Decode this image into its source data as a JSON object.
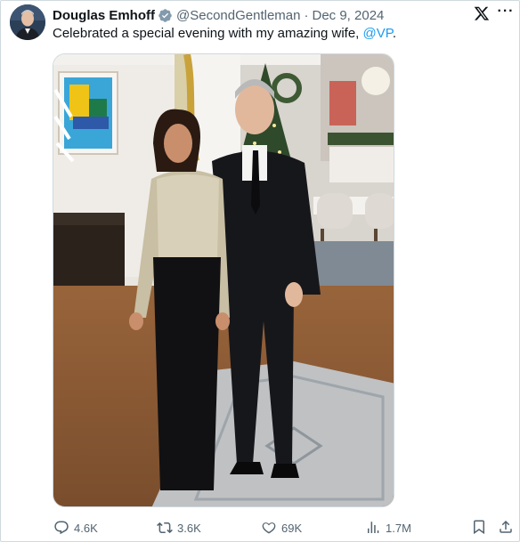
{
  "tweet": {
    "author_name": "Douglas Emhoff",
    "author_handle": "@SecondGentleman",
    "separator": "·",
    "date": "Dec 9, 2024",
    "text_before": "Celebrated a special evening with my amazing wife, ",
    "mention": "@VP",
    "text_after": "."
  },
  "icons": {
    "verified": "verified-badge-icon",
    "platform": "x-logo-icon",
    "more": "more-options-icon"
  },
  "more_label": "···",
  "actions": {
    "replies": "4.6K",
    "reposts": "3.6K",
    "likes": "69K",
    "views": "1.7M"
  },
  "colors": {
    "text_primary": "#0f1419",
    "text_secondary": "#536471",
    "link": "#1d9bf0",
    "border": "#cfd9de"
  }
}
